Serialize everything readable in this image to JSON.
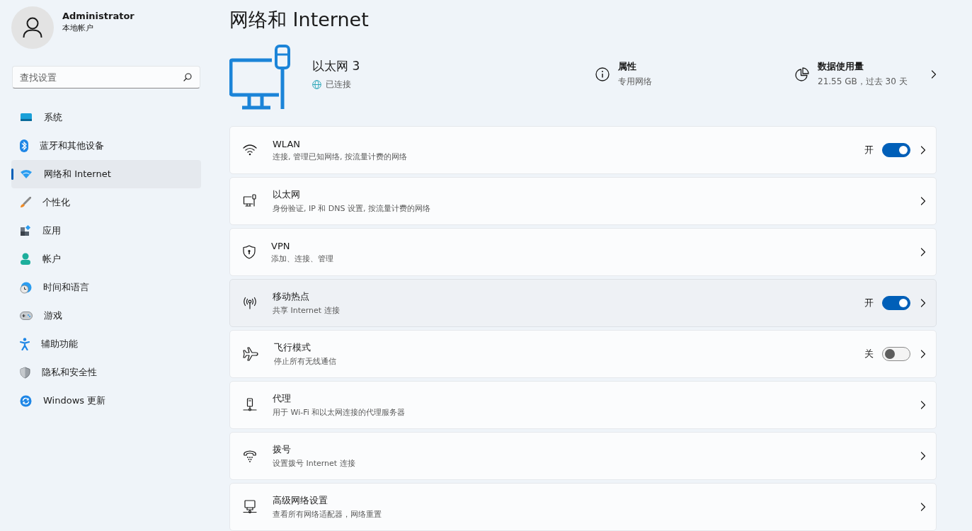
{
  "account": {
    "name": "Administrator",
    "type": "本地帐户"
  },
  "search": {
    "placeholder": "查找设置"
  },
  "sidebar": {
    "items": [
      {
        "label": "系统",
        "selected": false
      },
      {
        "label": "蓝牙和其他设备",
        "selected": false
      },
      {
        "label": "网络和 Internet",
        "selected": true
      },
      {
        "label": "个性化",
        "selected": false
      },
      {
        "label": "应用",
        "selected": false
      },
      {
        "label": "帐户",
        "selected": false
      },
      {
        "label": "时间和语言",
        "selected": false
      },
      {
        "label": "游戏",
        "selected": false
      },
      {
        "label": "辅助功能",
        "selected": false
      },
      {
        "label": "隐私和安全性",
        "selected": false
      },
      {
        "label": "Windows 更新",
        "selected": false
      }
    ]
  },
  "page_title": "网络和 Internet",
  "connection": {
    "name": "以太网 3",
    "status": "已连接",
    "properties": {
      "title": "属性",
      "subtitle": "专用网络"
    },
    "data_usage": {
      "title": "数据使用量",
      "subtitle": "21.55 GB，过去 30 天"
    }
  },
  "settings": [
    {
      "title": "WLAN",
      "subtitle": "连接, 管理已知网络, 按流量计费的网络",
      "hovered": false,
      "toggle": {
        "on": true,
        "label": "开"
      }
    },
    {
      "title": "以太网",
      "subtitle": "身份验证, IP 和 DNS 设置, 按流量计费的网络",
      "hovered": false
    },
    {
      "title": "VPN",
      "subtitle": "添加、连接、管理",
      "hovered": false
    },
    {
      "title": "移动热点",
      "subtitle": "共享 Internet 连接",
      "hovered": true,
      "toggle": {
        "on": true,
        "label": "开"
      }
    },
    {
      "title": "飞行模式",
      "subtitle": "停止所有无线通信",
      "hovered": false,
      "toggle": {
        "on": false,
        "label": "关"
      }
    },
    {
      "title": "代理",
      "subtitle": "用于 Wi-Fi 和以太网连接的代理服务器",
      "hovered": false
    },
    {
      "title": "拨号",
      "subtitle": "设置拨号 Internet 连接",
      "hovered": false
    },
    {
      "title": "高级网络设置",
      "subtitle": "查看所有网络适配器，网络重置",
      "hovered": false
    }
  ]
}
